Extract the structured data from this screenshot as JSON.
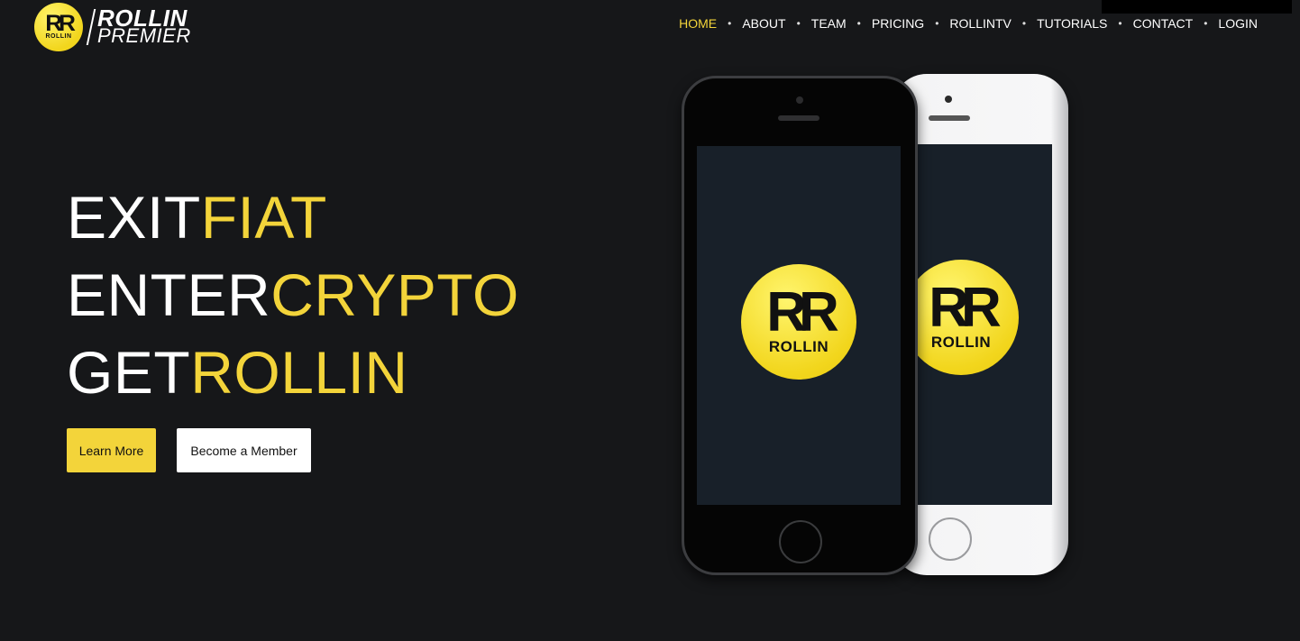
{
  "logo": {
    "badge_mark": "RR",
    "badge_sub": "ROLLIN",
    "line1": "ROLLIN",
    "line2": "PREMIER"
  },
  "nav": {
    "items": [
      "HOME",
      "ABOUT",
      "TEAM",
      "PRICING",
      "ROLLINTV",
      "TUTORIALS",
      "CONTACT",
      "LOGIN"
    ],
    "active": "HOME",
    "separator": "•"
  },
  "hero": {
    "line1": {
      "white": "EXIT",
      "yellow": "FIAT"
    },
    "line2": {
      "white": "ENTER",
      "yellow": "CRYPTO"
    },
    "line3": {
      "white": "GET",
      "yellow": "ROLLIN"
    }
  },
  "buttons": {
    "learn_more": "Learn More",
    "become_member": "Become a Member"
  },
  "app_logo": {
    "mark": "RR",
    "sub": "ROLLIN"
  },
  "colors": {
    "background": "#161719",
    "accent": "#f3d43a",
    "white": "#ffffff"
  }
}
